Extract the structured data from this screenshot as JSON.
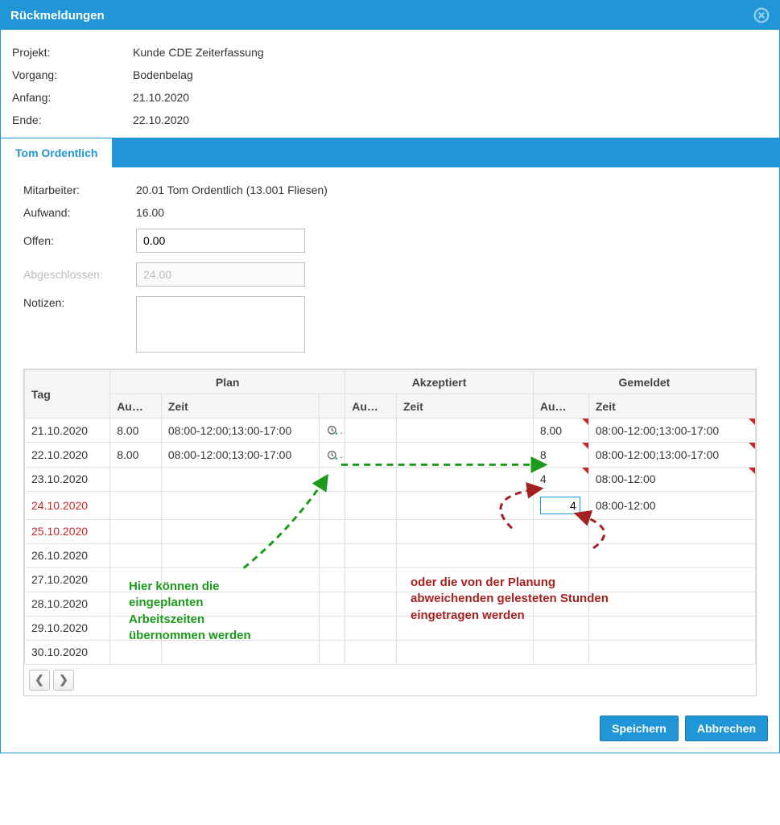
{
  "dialog": {
    "title": "Rückmeldungen"
  },
  "header": {
    "projekt_label": "Projekt:",
    "projekt": "Kunde CDE Zeiterfassung",
    "vorgang_label": "Vorgang:",
    "vorgang": "Bodenbelag",
    "anfang_label": "Anfang:",
    "anfang": "21.10.2020",
    "ende_label": "Ende:",
    "ende": "22.10.2020"
  },
  "tab": {
    "label": "Tom Ordentlich"
  },
  "form": {
    "mitarbeiter_label": "Mitarbeiter:",
    "mitarbeiter": "20.01 Tom Ordentlich (13.001 Fliesen)",
    "aufwand_label": "Aufwand:",
    "aufwand": "16.00",
    "offen_label": "Offen:",
    "offen_value": "0.00",
    "abgeschlossen_label": "Abgeschlossen:",
    "abgeschlossen_value": "24.00",
    "notizen_label": "Notizen:",
    "notizen_value": ""
  },
  "grid": {
    "headers": {
      "tag": "Tag",
      "plan": "Plan",
      "akzeptiert": "Akzeptiert",
      "gemeldet": "Gemeldet",
      "aufwand": "Au…",
      "zeit": "Zeit"
    },
    "rows": [
      {
        "tag": "21.10.2020",
        "plan_auf": "8.00",
        "plan_zeit": "08:00-12:00;13:00-17:00",
        "akz_auf": "",
        "akz_zeit": "",
        "gem_auf": "8.00",
        "gem_zeit": "08:00-12:00;13:00-17:00",
        "weekend": false,
        "icon": true,
        "dirty": true
      },
      {
        "tag": "22.10.2020",
        "plan_auf": "8.00",
        "plan_zeit": "08:00-12:00;13:00-17:00",
        "akz_auf": "",
        "akz_zeit": "",
        "gem_auf": "8",
        "gem_zeit": "08:00-12:00;13:00-17:00",
        "weekend": false,
        "icon": true,
        "dirty": true
      },
      {
        "tag": "23.10.2020",
        "plan_auf": "",
        "plan_zeit": "",
        "akz_auf": "",
        "akz_zeit": "",
        "gem_auf": "4",
        "gem_zeit": "08:00-12:00",
        "weekend": false,
        "icon": false,
        "dirty": true
      },
      {
        "tag": "24.10.2020",
        "plan_auf": "",
        "plan_zeit": "",
        "akz_auf": "",
        "akz_zeit": "",
        "gem_auf": "4",
        "gem_zeit": "08:00-12:00",
        "weekend": true,
        "icon": false,
        "dirty": false,
        "editing": true
      },
      {
        "tag": "25.10.2020",
        "plan_auf": "",
        "plan_zeit": "",
        "akz_auf": "",
        "akz_zeit": "",
        "gem_auf": "",
        "gem_zeit": "",
        "weekend": true,
        "icon": false,
        "dirty": false
      },
      {
        "tag": "26.10.2020",
        "plan_auf": "",
        "plan_zeit": "",
        "akz_auf": "",
        "akz_zeit": "",
        "gem_auf": "",
        "gem_zeit": "",
        "weekend": false,
        "icon": false,
        "dirty": false
      },
      {
        "tag": "27.10.2020",
        "plan_auf": "",
        "plan_zeit": "",
        "akz_auf": "",
        "akz_zeit": "",
        "gem_auf": "",
        "gem_zeit": "",
        "weekend": false,
        "icon": false,
        "dirty": false
      },
      {
        "tag": "28.10.2020",
        "plan_auf": "",
        "plan_zeit": "",
        "akz_auf": "",
        "akz_zeit": "",
        "gem_auf": "",
        "gem_zeit": "",
        "weekend": false,
        "icon": false,
        "dirty": false
      },
      {
        "tag": "29.10.2020",
        "plan_auf": "",
        "plan_zeit": "",
        "akz_auf": "",
        "akz_zeit": "",
        "gem_auf": "",
        "gem_zeit": "",
        "weekend": false,
        "icon": false,
        "dirty": false
      },
      {
        "tag": "30.10.2020",
        "plan_auf": "",
        "plan_zeit": "",
        "akz_auf": "",
        "akz_zeit": "",
        "gem_auf": "",
        "gem_zeit": "",
        "weekend": false,
        "icon": false,
        "dirty": false
      }
    ]
  },
  "annotations": {
    "green": "Hier können die\neingeplanten\nArbeitszeiten\nübernommen werden",
    "red": "oder die von der Planung\nabweichenden gelesteten Stunden\neingetragen werden"
  },
  "footer": {
    "save": "Speichern",
    "cancel": "Abbrechen"
  }
}
